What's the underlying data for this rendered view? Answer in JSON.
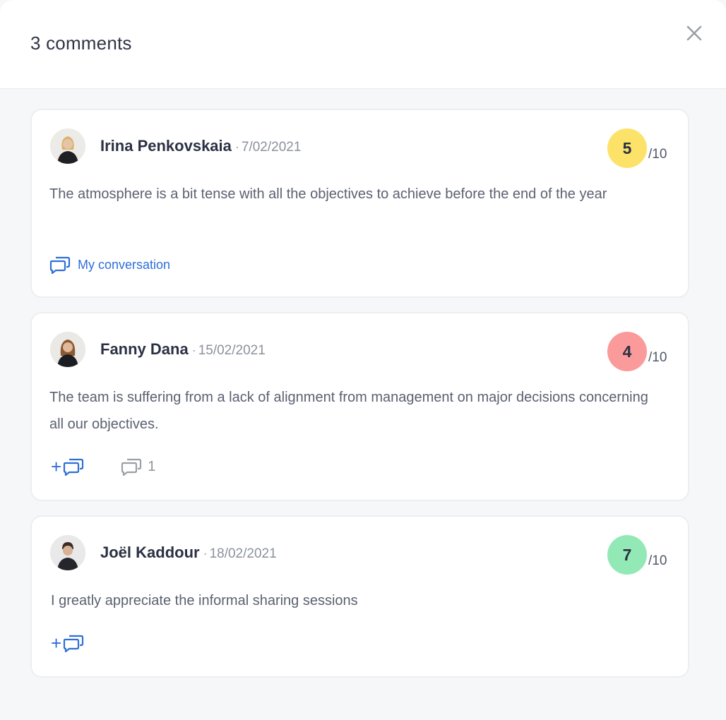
{
  "header": {
    "title": "3 comments"
  },
  "comments": [
    {
      "author": "Irina Penkovskaia",
      "separator": "·",
      "date": "7/02/2021",
      "score": "5",
      "score_max": "/10",
      "score_color": "#fde26a",
      "text": "The atmosphere is a bit tense with all the objectives to achieve before the end of the year",
      "conversation_label": "My conversation"
    },
    {
      "author": "Fanny Dana",
      "separator": "·",
      "date": "15/02/2021",
      "score": "4",
      "score_max": "/10",
      "score_color": "#fb9a9a",
      "text": "The team is suffering from a lack of alignment from management on major decisions concerning all our objectives.",
      "add_reply_label": "+",
      "reply_count": "1"
    },
    {
      "author": "Joël Kaddour",
      "separator": "·",
      "date": "18/02/2021",
      "score": "7",
      "score_max": "/10",
      "score_color": "#93e9b6",
      "text": "I greatly appreciate the informal sharing sessions",
      "add_reply_label": "+"
    }
  ],
  "colors": {
    "accent": "#2f6fd8",
    "background": "#f6f7f8",
    "card": "#ffffff"
  }
}
